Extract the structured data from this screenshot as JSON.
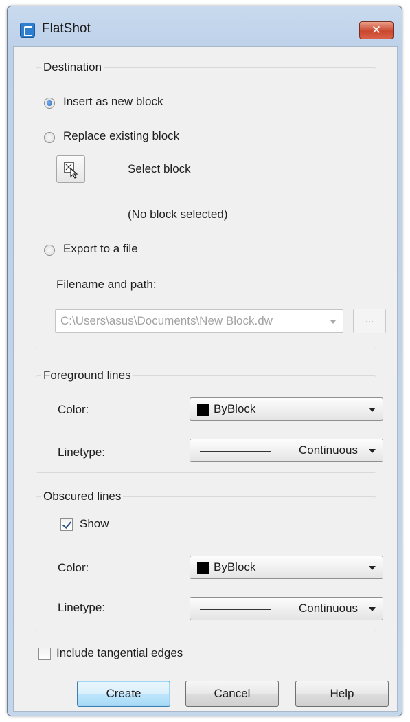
{
  "window": {
    "title": "FlatShot",
    "close_label": "✕"
  },
  "destination": {
    "label": "Destination",
    "options": [
      {
        "label": "Insert as new block",
        "checked": true
      },
      {
        "label": "Replace existing block",
        "checked": false
      },
      {
        "label": "Export to a file",
        "checked": false
      }
    ],
    "select_block_label": "Select block",
    "select_block_icon": "select-block-icon",
    "block_status": "(No block selected)",
    "filename_label": "Filename and path:",
    "filename_value": "C:\\Users\\asus\\Documents\\New Block.dw",
    "browse_label": "..."
  },
  "foreground": {
    "label": "Foreground lines",
    "color_label": "Color:",
    "color_value": "ByBlock",
    "color_swatch": "#000000",
    "linetype_label": "Linetype:",
    "linetype_value": "Continuous"
  },
  "obscured": {
    "label": "Obscured lines",
    "show_label": "Show",
    "show_checked": true,
    "color_label": "Color:",
    "color_value": "ByBlock",
    "color_swatch": "#000000",
    "linetype_label": "Linetype:",
    "linetype_value": "Continuous"
  },
  "tangential": {
    "label": "Include tangential edges",
    "checked": false
  },
  "buttons": {
    "create": "Create",
    "cancel": "Cancel",
    "help": "Help"
  }
}
